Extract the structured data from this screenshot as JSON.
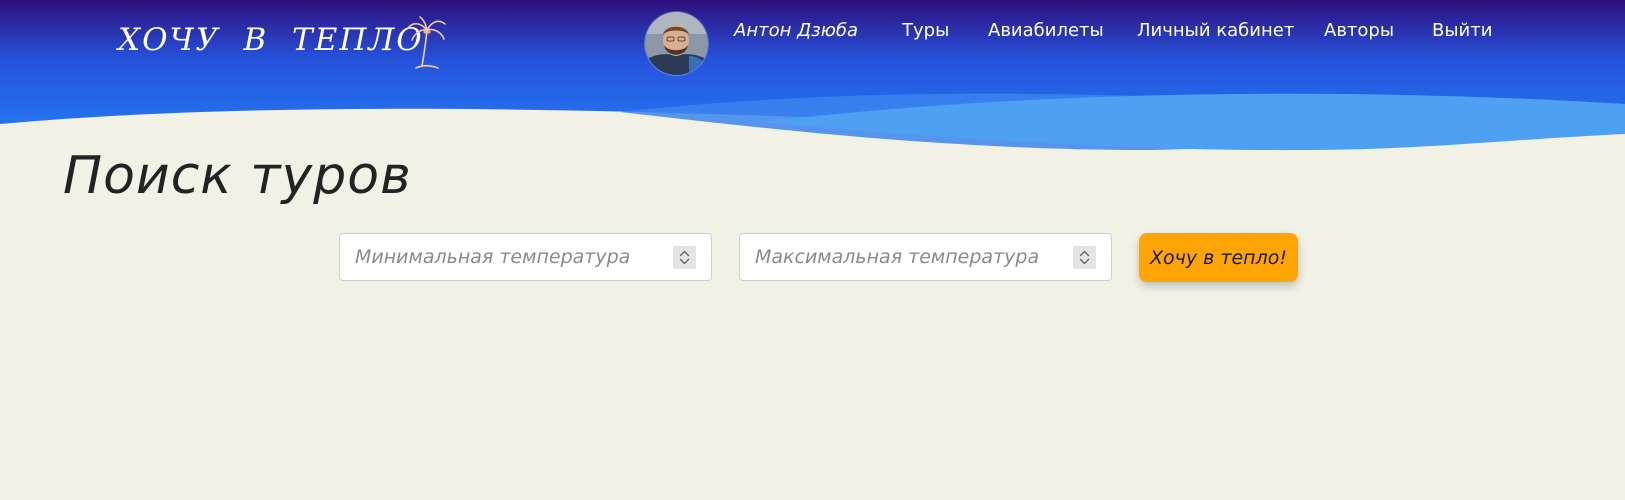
{
  "header": {
    "logo_text": "ХОЧУ  В  ТЕПЛО",
    "logo_icon": "palm-tree-icon",
    "colors": {
      "top": "#2f0f7e",
      "mid": "#2553dc",
      "bottom": "#2575f0",
      "wave_light": "#4da0f2",
      "wave_mid": "#3b84ee"
    }
  },
  "nav": {
    "user_name": "Антон Дзюба",
    "avatar": "user-avatar",
    "items": [
      {
        "label": "Туры"
      },
      {
        "label": "Авиабилеты"
      },
      {
        "label": "Личный кабинет"
      },
      {
        "label": "Авторы"
      },
      {
        "label": "Выйти"
      }
    ]
  },
  "main": {
    "title": "Поиск туров",
    "min_temp": {
      "placeholder": "Минимальная температура",
      "value": ""
    },
    "max_temp": {
      "placeholder": "Максимальная температура",
      "value": ""
    },
    "submit_label": "Хочу в тепло!"
  },
  "colors": {
    "page_background": "#f1f1e5",
    "accent_button": "#ffa405"
  }
}
